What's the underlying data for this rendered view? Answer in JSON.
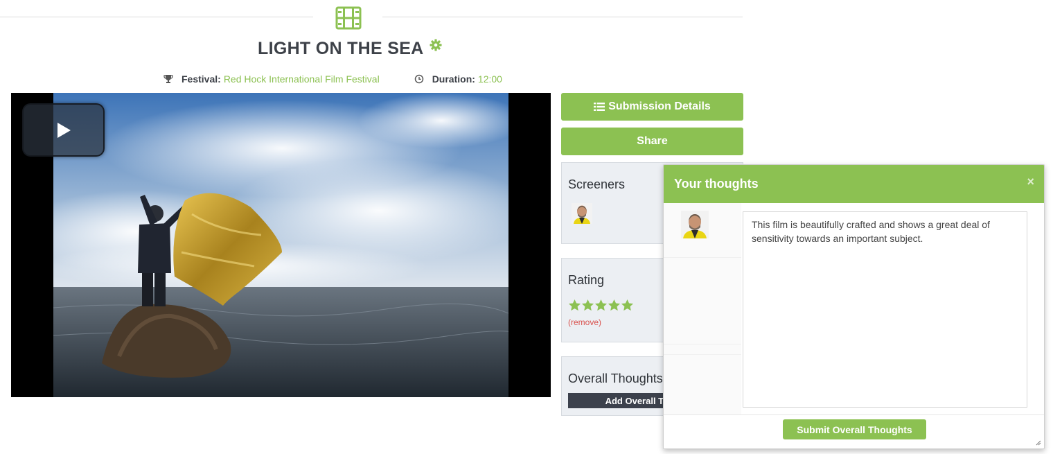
{
  "header": {
    "icon": "film-icon",
    "film_title": "LIGHT ON THE SEA",
    "settings_icon": "gear-icon"
  },
  "meta": {
    "festival_label": "Festival:",
    "festival_value": "Red Hock International Film Festival",
    "duration_label": "Duration:",
    "duration_value": "12:00",
    "festival_icon": "trophy-icon",
    "duration_icon": "clock-icon"
  },
  "player": {
    "play_icon": "play-icon"
  },
  "actions": {
    "submission_details_label": "Submission Details",
    "submission_details_icon": "list-icon",
    "share_label": "Share"
  },
  "screeners": {
    "heading": "Screeners"
  },
  "rating": {
    "heading": "Rating",
    "stars": 5,
    "max_stars": 5,
    "remove_label": "(remove)"
  },
  "overall": {
    "heading": "Overall Thoughts",
    "add_label": "Add Overall Thoughts"
  },
  "modal": {
    "title": "Your thoughts",
    "close_symbol": "×",
    "thoughts_text": "This film is beautifully crafted and shows a great deal of sensitivity towards an important subject.",
    "submit_label": "Submit Overall Thoughts"
  },
  "colors": {
    "accent": "#8cc152",
    "dark_button": "#3c414c",
    "panel_bg": "#eceff3",
    "remove_link": "#d9534f"
  }
}
